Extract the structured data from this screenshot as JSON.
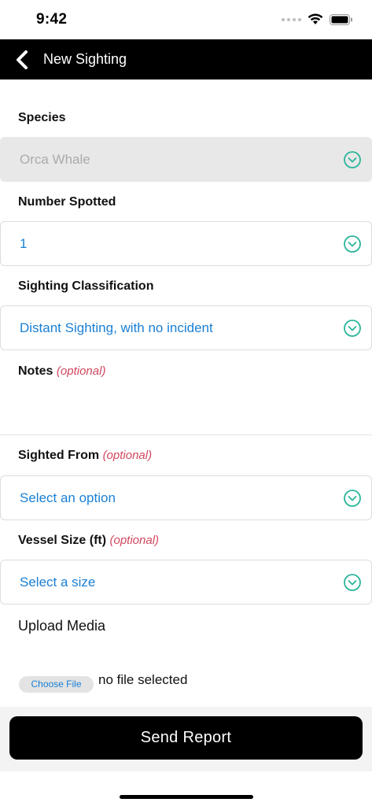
{
  "status_bar": {
    "time": "9:42"
  },
  "nav": {
    "title": "New Sighting"
  },
  "form": {
    "species": {
      "label": "Species",
      "value": "Orca Whale"
    },
    "number_spotted": {
      "label": "Number Spotted",
      "value": "1"
    },
    "classification": {
      "label": "Sighting Classification",
      "value": "Distant Sighting, with no incident"
    },
    "notes": {
      "label": "Notes",
      "optional": "(optional)"
    },
    "sighted_from": {
      "label": "Sighted From",
      "optional": "(optional)",
      "placeholder": "Select an option"
    },
    "vessel_size": {
      "label": "Vessel Size (ft)",
      "optional": "(optional)",
      "placeholder": "Select a size"
    },
    "upload": {
      "label": "Upload Media",
      "button": "Choose File",
      "status": "no file selected"
    }
  },
  "submit": {
    "label": "Send Report"
  },
  "colors": {
    "accent": "#1a7fd4",
    "chevron": "#2bb59a",
    "optional": "#d1475e",
    "nav_bg": "#000000"
  },
  "icons": [
    "back-chevron-icon",
    "chevron-down-icon",
    "wifi-icon",
    "battery-icon",
    "signal-icon"
  ]
}
